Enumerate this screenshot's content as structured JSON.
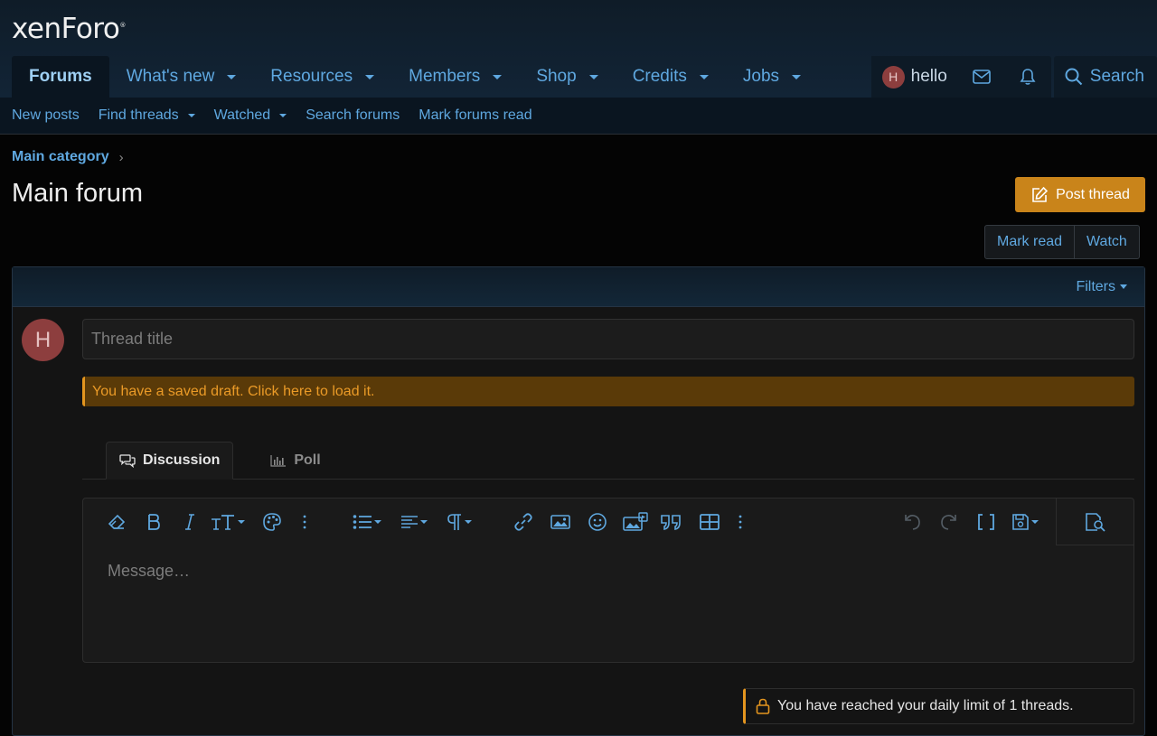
{
  "header": {
    "logo": "xenForo",
    "logo_mark": "®",
    "nav_tabs": [
      {
        "label": "Forums",
        "active": true,
        "dropdown": false
      },
      {
        "label": "What's new",
        "active": false,
        "dropdown": true
      },
      {
        "label": "Resources",
        "active": false,
        "dropdown": true
      },
      {
        "label": "Members",
        "active": false,
        "dropdown": true
      },
      {
        "label": "Shop",
        "active": false,
        "dropdown": true
      },
      {
        "label": "Credits",
        "active": false,
        "dropdown": true
      },
      {
        "label": "Jobs",
        "active": false,
        "dropdown": true
      }
    ],
    "user": {
      "initial": "H",
      "name": "hello"
    },
    "icons": [
      "envelope-icon",
      "bell-icon",
      "search-icon"
    ],
    "search_label": "Search"
  },
  "subnav": {
    "items": [
      {
        "label": "New posts",
        "dropdown": false
      },
      {
        "label": "Find threads",
        "dropdown": true
      },
      {
        "label": "Watched",
        "dropdown": true
      },
      {
        "label": "Search forums",
        "dropdown": false
      },
      {
        "label": "Mark forums read",
        "dropdown": false
      }
    ]
  },
  "breadcrumb": {
    "label": "Main category",
    "separator": "›"
  },
  "page": {
    "title": "Main forum",
    "post_thread_label": "Post thread",
    "mark_read_label": "Mark read",
    "watch_label": "Watch"
  },
  "block": {
    "filters_label": "Filters",
    "avatar_initial": "H",
    "title_placeholder": "Thread title",
    "draft_notice": "You have a saved draft. Click here to load it.",
    "tabs": [
      {
        "label": "Discussion",
        "active": true,
        "icon": "chat-bubbles-icon"
      },
      {
        "label": "Poll",
        "active": false,
        "icon": "bar-chart-icon"
      }
    ],
    "editor": {
      "placeholder": "Message…",
      "toolbar_icons": [
        "eraser-icon",
        "bold-icon",
        "italic-icon",
        "text-size-icon",
        "palette-icon",
        "more-icon",
        "list-icon",
        "align-icon",
        "paragraph-icon",
        "link-icon",
        "image-icon",
        "smiley-icon",
        "media-icon",
        "quote-icon",
        "table-icon",
        "more-icon",
        "undo-icon",
        "redo-icon",
        "bbcode-icon",
        "draft-save-icon",
        "preview-icon"
      ]
    },
    "limit_notice": "You have reached your daily limit of 1 threads."
  },
  "colors": {
    "accent": "#5fa8e0",
    "button": "#c9841a",
    "warning": "#e3951f",
    "avatar": "#8d3e3e"
  }
}
